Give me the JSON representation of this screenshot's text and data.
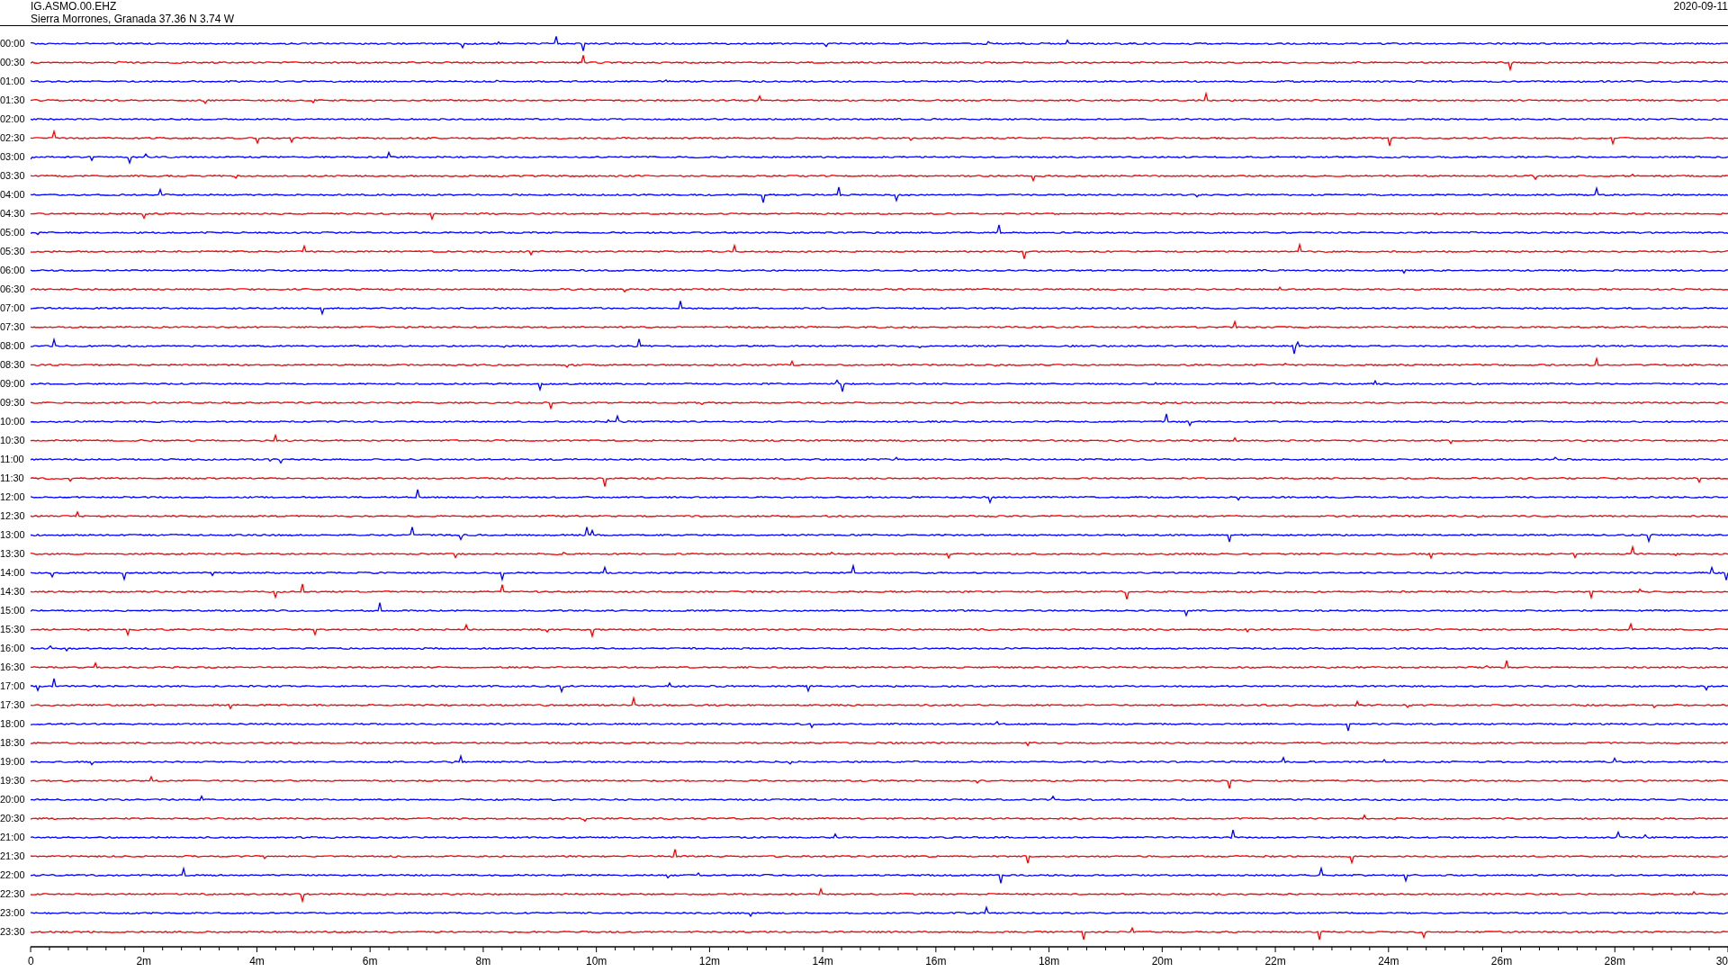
{
  "header": {
    "station": "IG.ASMO.00.EHZ",
    "location": "Sierra Morrones, Granada  37.36 N 3.74 W",
    "date": "2020-09-11"
  },
  "rows": [
    {
      "time": "00:00",
      "color": "#0000ff"
    },
    {
      "time": "00:30",
      "color": "#ff0000"
    },
    {
      "time": "01:00",
      "color": "#0000ff"
    },
    {
      "time": "01:30",
      "color": "#ff0000"
    },
    {
      "time": "02:00",
      "color": "#0000ff"
    },
    {
      "time": "02:30",
      "color": "#ff0000"
    },
    {
      "time": "03:00",
      "color": "#0000ff"
    },
    {
      "time": "03:30",
      "color": "#ff0000"
    },
    {
      "time": "04:00",
      "color": "#0000ff"
    },
    {
      "time": "04:30",
      "color": "#ff0000"
    },
    {
      "time": "05:00",
      "color": "#0000ff"
    },
    {
      "time": "05:30",
      "color": "#ff0000"
    },
    {
      "time": "06:00",
      "color": "#0000ff"
    },
    {
      "time": "06:30",
      "color": "#ff0000"
    },
    {
      "time": "07:00",
      "color": "#0000ff"
    },
    {
      "time": "07:30",
      "color": "#ff0000"
    },
    {
      "time": "08:00",
      "color": "#0000ff"
    },
    {
      "time": "08:30",
      "color": "#ff0000"
    },
    {
      "time": "09:00",
      "color": "#0000ff"
    },
    {
      "time": "09:30",
      "color": "#ff0000"
    },
    {
      "time": "10:00",
      "color": "#0000ff"
    },
    {
      "time": "10:30",
      "color": "#ff0000"
    },
    {
      "time": "11:00",
      "color": "#0000ff"
    },
    {
      "time": "11:30",
      "color": "#ff0000"
    },
    {
      "time": "12:00",
      "color": "#0000ff"
    },
    {
      "time": "12:30",
      "color": "#ff0000"
    },
    {
      "time": "13:00",
      "color": "#0000ff"
    },
    {
      "time": "13:30",
      "color": "#ff0000"
    },
    {
      "time": "14:00",
      "color": "#0000ff"
    },
    {
      "time": "14:30",
      "color": "#ff0000"
    },
    {
      "time": "15:00",
      "color": "#0000ff"
    },
    {
      "time": "15:30",
      "color": "#ff0000"
    },
    {
      "time": "16:00",
      "color": "#0000ff"
    },
    {
      "time": "16:30",
      "color": "#ff0000"
    },
    {
      "time": "17:00",
      "color": "#0000ff"
    },
    {
      "time": "17:30",
      "color": "#ff0000"
    },
    {
      "time": "18:00",
      "color": "#0000ff"
    },
    {
      "time": "18:30",
      "color": "#ff0000"
    },
    {
      "time": "19:00",
      "color": "#0000ff"
    },
    {
      "time": "19:30",
      "color": "#ff0000"
    },
    {
      "time": "20:00",
      "color": "#0000ff"
    },
    {
      "time": "20:30",
      "color": "#ff0000"
    },
    {
      "time": "21:00",
      "color": "#0000ff"
    },
    {
      "time": "21:30",
      "color": "#ff0000"
    },
    {
      "time": "22:00",
      "color": "#0000ff"
    },
    {
      "time": "22:30",
      "color": "#ff0000"
    },
    {
      "time": "23:00",
      "color": "#0000ff"
    },
    {
      "time": "23:30",
      "color": "#ff0000"
    }
  ],
  "x_axis": {
    "labels": [
      "0",
      "2m",
      "4m",
      "6m",
      "8m",
      "10m",
      "12m",
      "14m",
      "16m",
      "18m",
      "20m",
      "22m",
      "24m",
      "26m",
      "28m",
      "30"
    ]
  }
}
